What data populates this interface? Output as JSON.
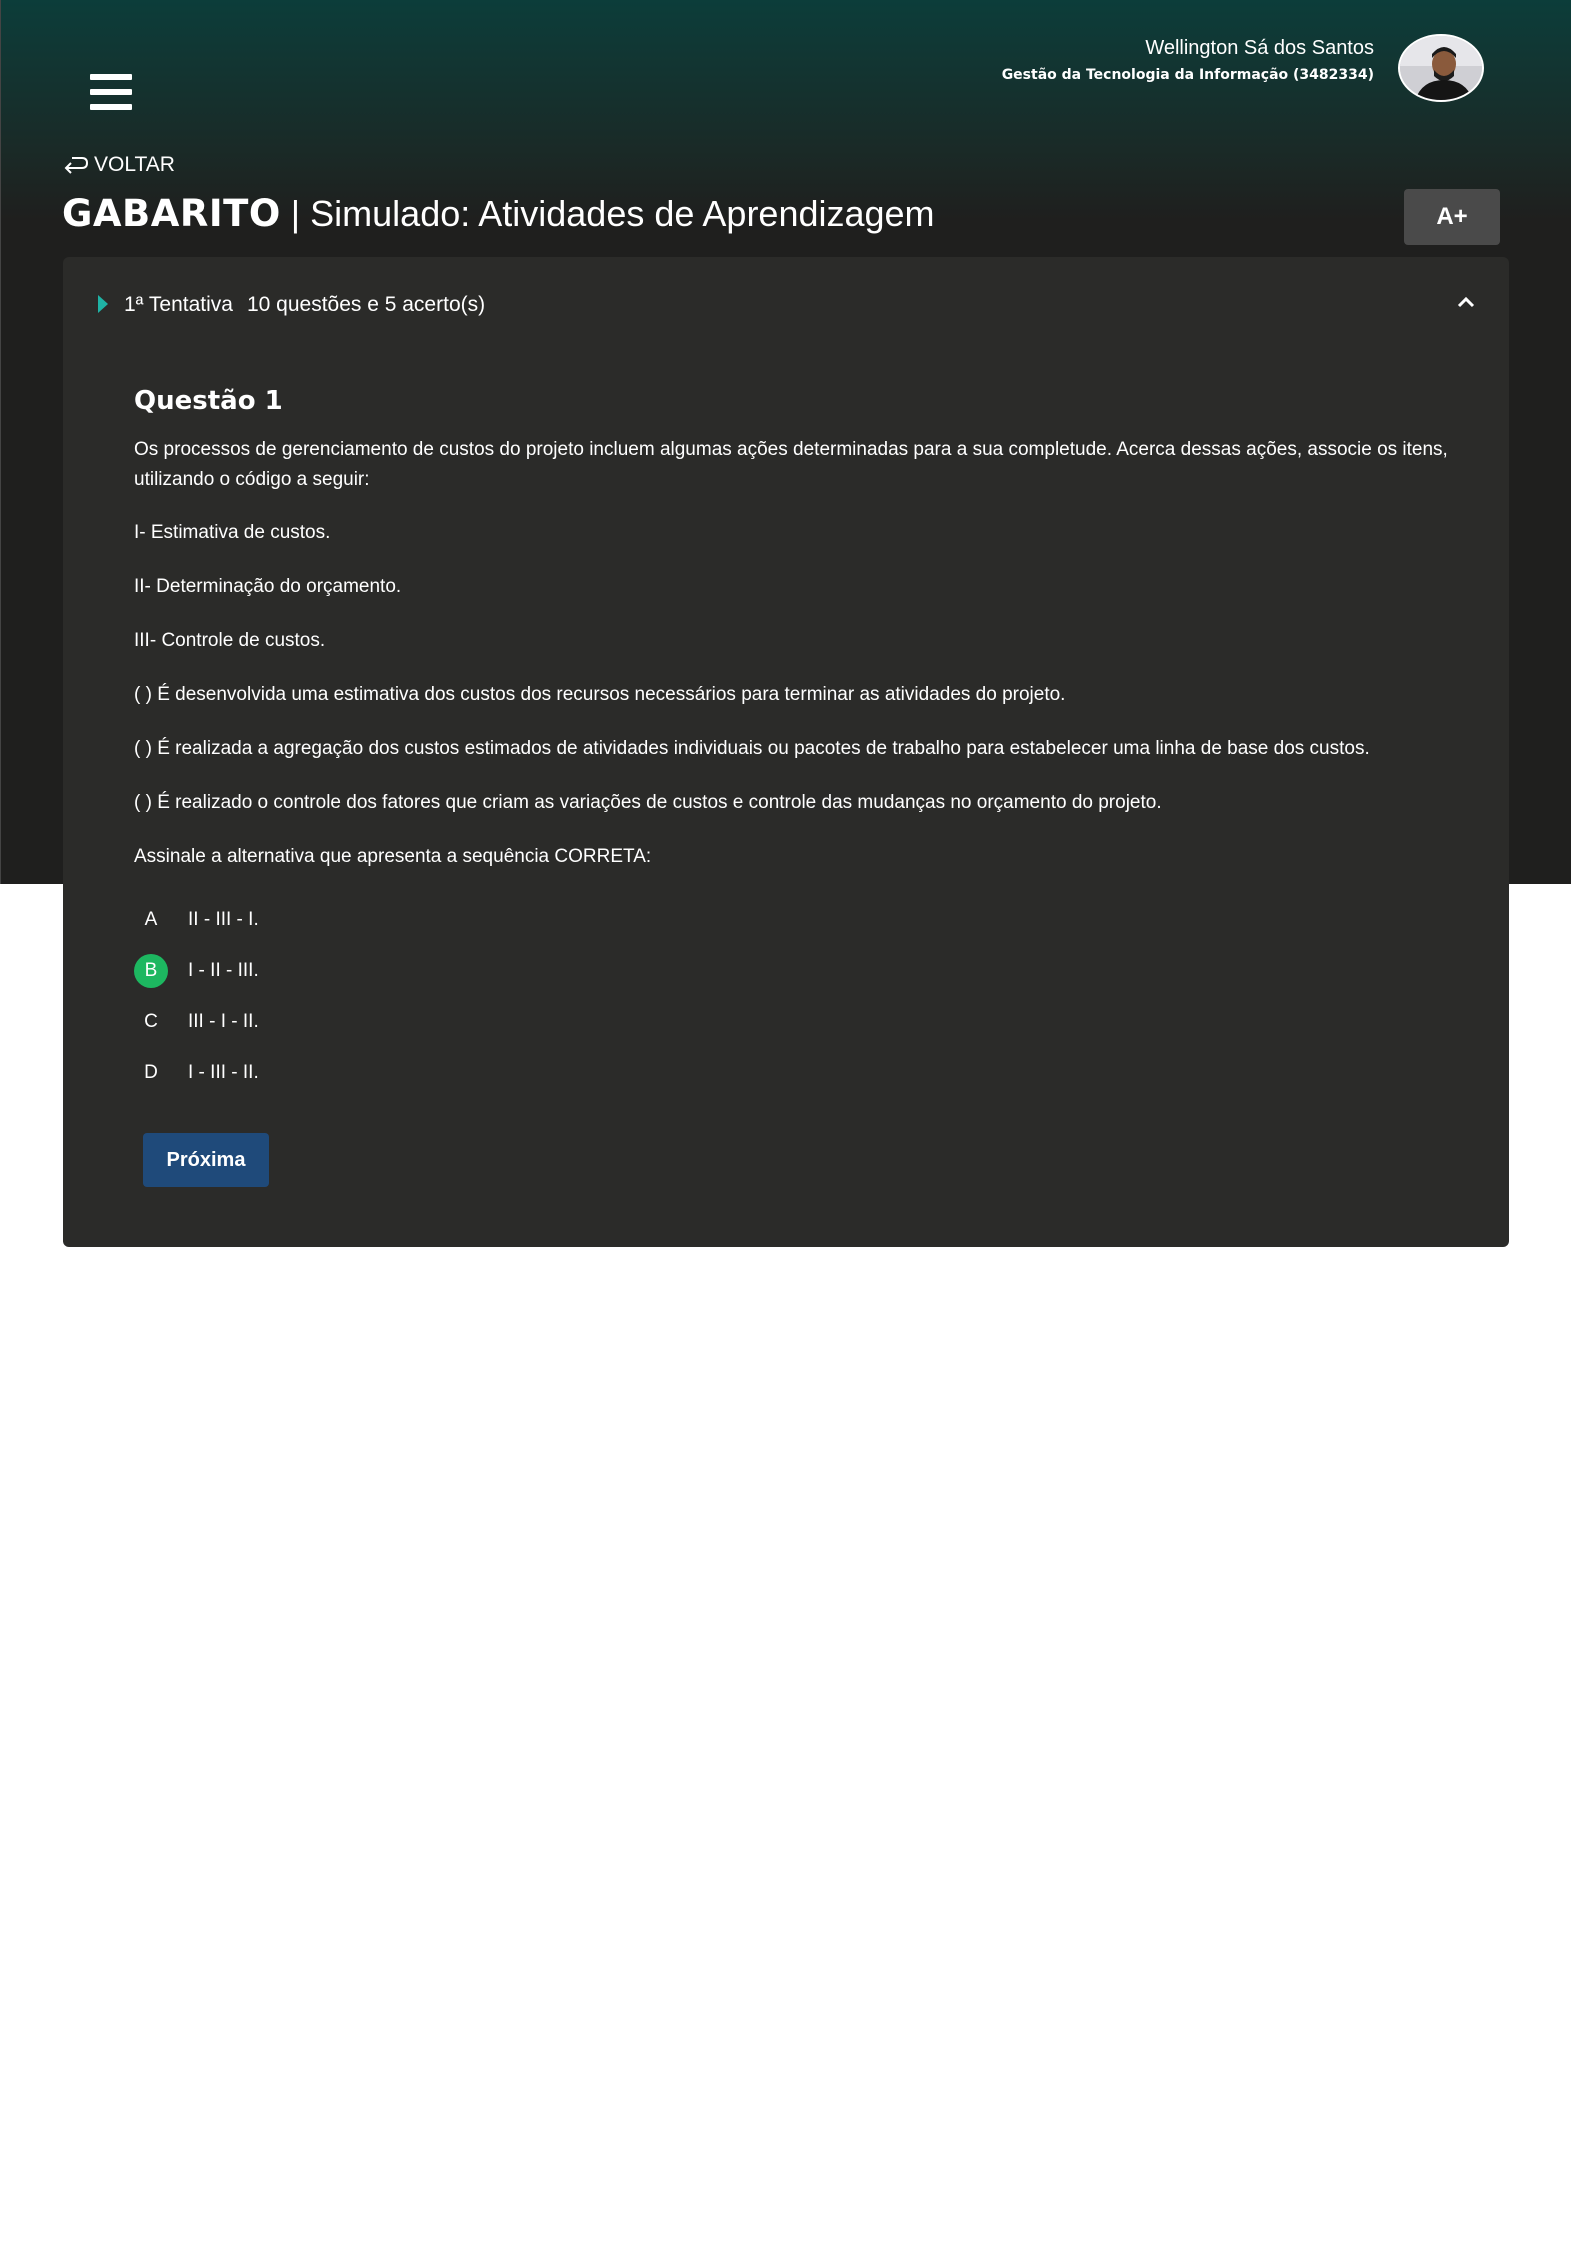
{
  "user": {
    "name": "Wellington Sá dos Santos",
    "course": "Gestão da Tecnologia da Informação (3482334)"
  },
  "nav": {
    "back_label": "VOLTAR",
    "font_size_button": "A+"
  },
  "title": {
    "strong": "GABARITO",
    "separator": "|",
    "rest": "Simulado: Atividades de Aprendizagem"
  },
  "attempt": {
    "label": "1ª Tentativa",
    "summary": "10 questões e 5 acerto(s)"
  },
  "question": {
    "title": "Questão 1",
    "intro": "Os processos de gerenciamento de custos do projeto incluem algumas ações determinadas para a sua completude. Acerca dessas ações, associe os itens, utilizando o código a seguir:",
    "items": [
      "I- Estimativa de custos.",
      "II- Determinação do orçamento.",
      "III- Controle de custos."
    ],
    "statements": [
      "(    ) É desenvolvida uma estimativa dos custos dos recursos necessários para terminar as atividades do projeto.",
      "(    ) É realizada a agregação dos custos estimados de atividades individuais ou pacotes de trabalho para estabelecer uma linha de base dos custos.",
      "(    ) É realizado o controle dos fatores que criam as variações de custos e controle das mudanças no orçamento do projeto."
    ],
    "prompt": "Assinale a alternativa que apresenta a sequência CORRETA:",
    "options": [
      {
        "letter": "A",
        "text": "II - III - I."
      },
      {
        "letter": "B",
        "text": "I - II - III."
      },
      {
        "letter": "C",
        "text": "III - I - II."
      },
      {
        "letter": "D",
        "text": "I - III - II."
      }
    ],
    "correct_color": "#1db760"
  },
  "actions": {
    "next_label": "Próxima"
  },
  "colors": {
    "header_top": "#0c3d3a",
    "card_bg": "#2b2b29",
    "accent_teal": "#1fb3a5",
    "next_button": "#1f4a7a"
  }
}
